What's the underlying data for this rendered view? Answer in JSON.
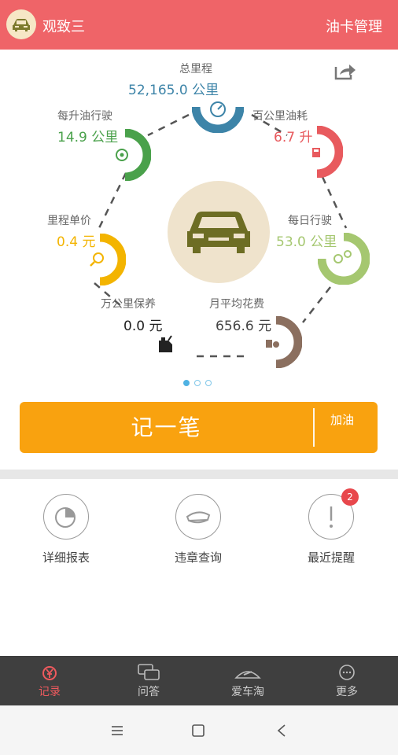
{
  "header": {
    "title": "观致三",
    "right_action": "油卡管理"
  },
  "stats": {
    "total_mileage": {
      "label": "总里程",
      "value": "52,165.0 公里",
      "color": "#3d84a8"
    },
    "per_100km": {
      "label": "百公里油耗",
      "value": "6.7 升",
      "color": "#e85a5e"
    },
    "km_per_liter": {
      "label": "每升油行驶",
      "value": "14.9 公里",
      "color": "#4aa14b"
    },
    "daily_km": {
      "label": "每日行驶",
      "value": "53.0 公里",
      "color": "#a5c770"
    },
    "cost_per_km": {
      "label": "里程单价",
      "value": "0.4 元",
      "color": "#f3b400"
    },
    "maintenance": {
      "label": "万公里保养",
      "value": "0.0 元",
      "color": "#222222"
    },
    "monthly_cost": {
      "label": "月平均花费",
      "value": "656.6 元",
      "color": "#444444"
    }
  },
  "record_button": {
    "main_label": "记一笔",
    "side_label": "加油"
  },
  "quick_actions": [
    {
      "label": "详细报表",
      "icon": "report-icon"
    },
    {
      "label": "违章查询",
      "icon": "police-cap-icon"
    },
    {
      "label": "最近提醒",
      "icon": "exclamation-icon",
      "badge": "2"
    }
  ],
  "bottom_nav": [
    {
      "label": "记录",
      "icon": "yen-record-icon",
      "active": true
    },
    {
      "label": "问答",
      "icon": "chat-bubbles-icon",
      "active": false
    },
    {
      "label": "爱车淘",
      "icon": "car-shop-icon",
      "active": false
    },
    {
      "label": "更多",
      "icon": "more-dots-icon",
      "active": false
    }
  ],
  "page_indicator": {
    "pages": 3,
    "current": 1
  }
}
